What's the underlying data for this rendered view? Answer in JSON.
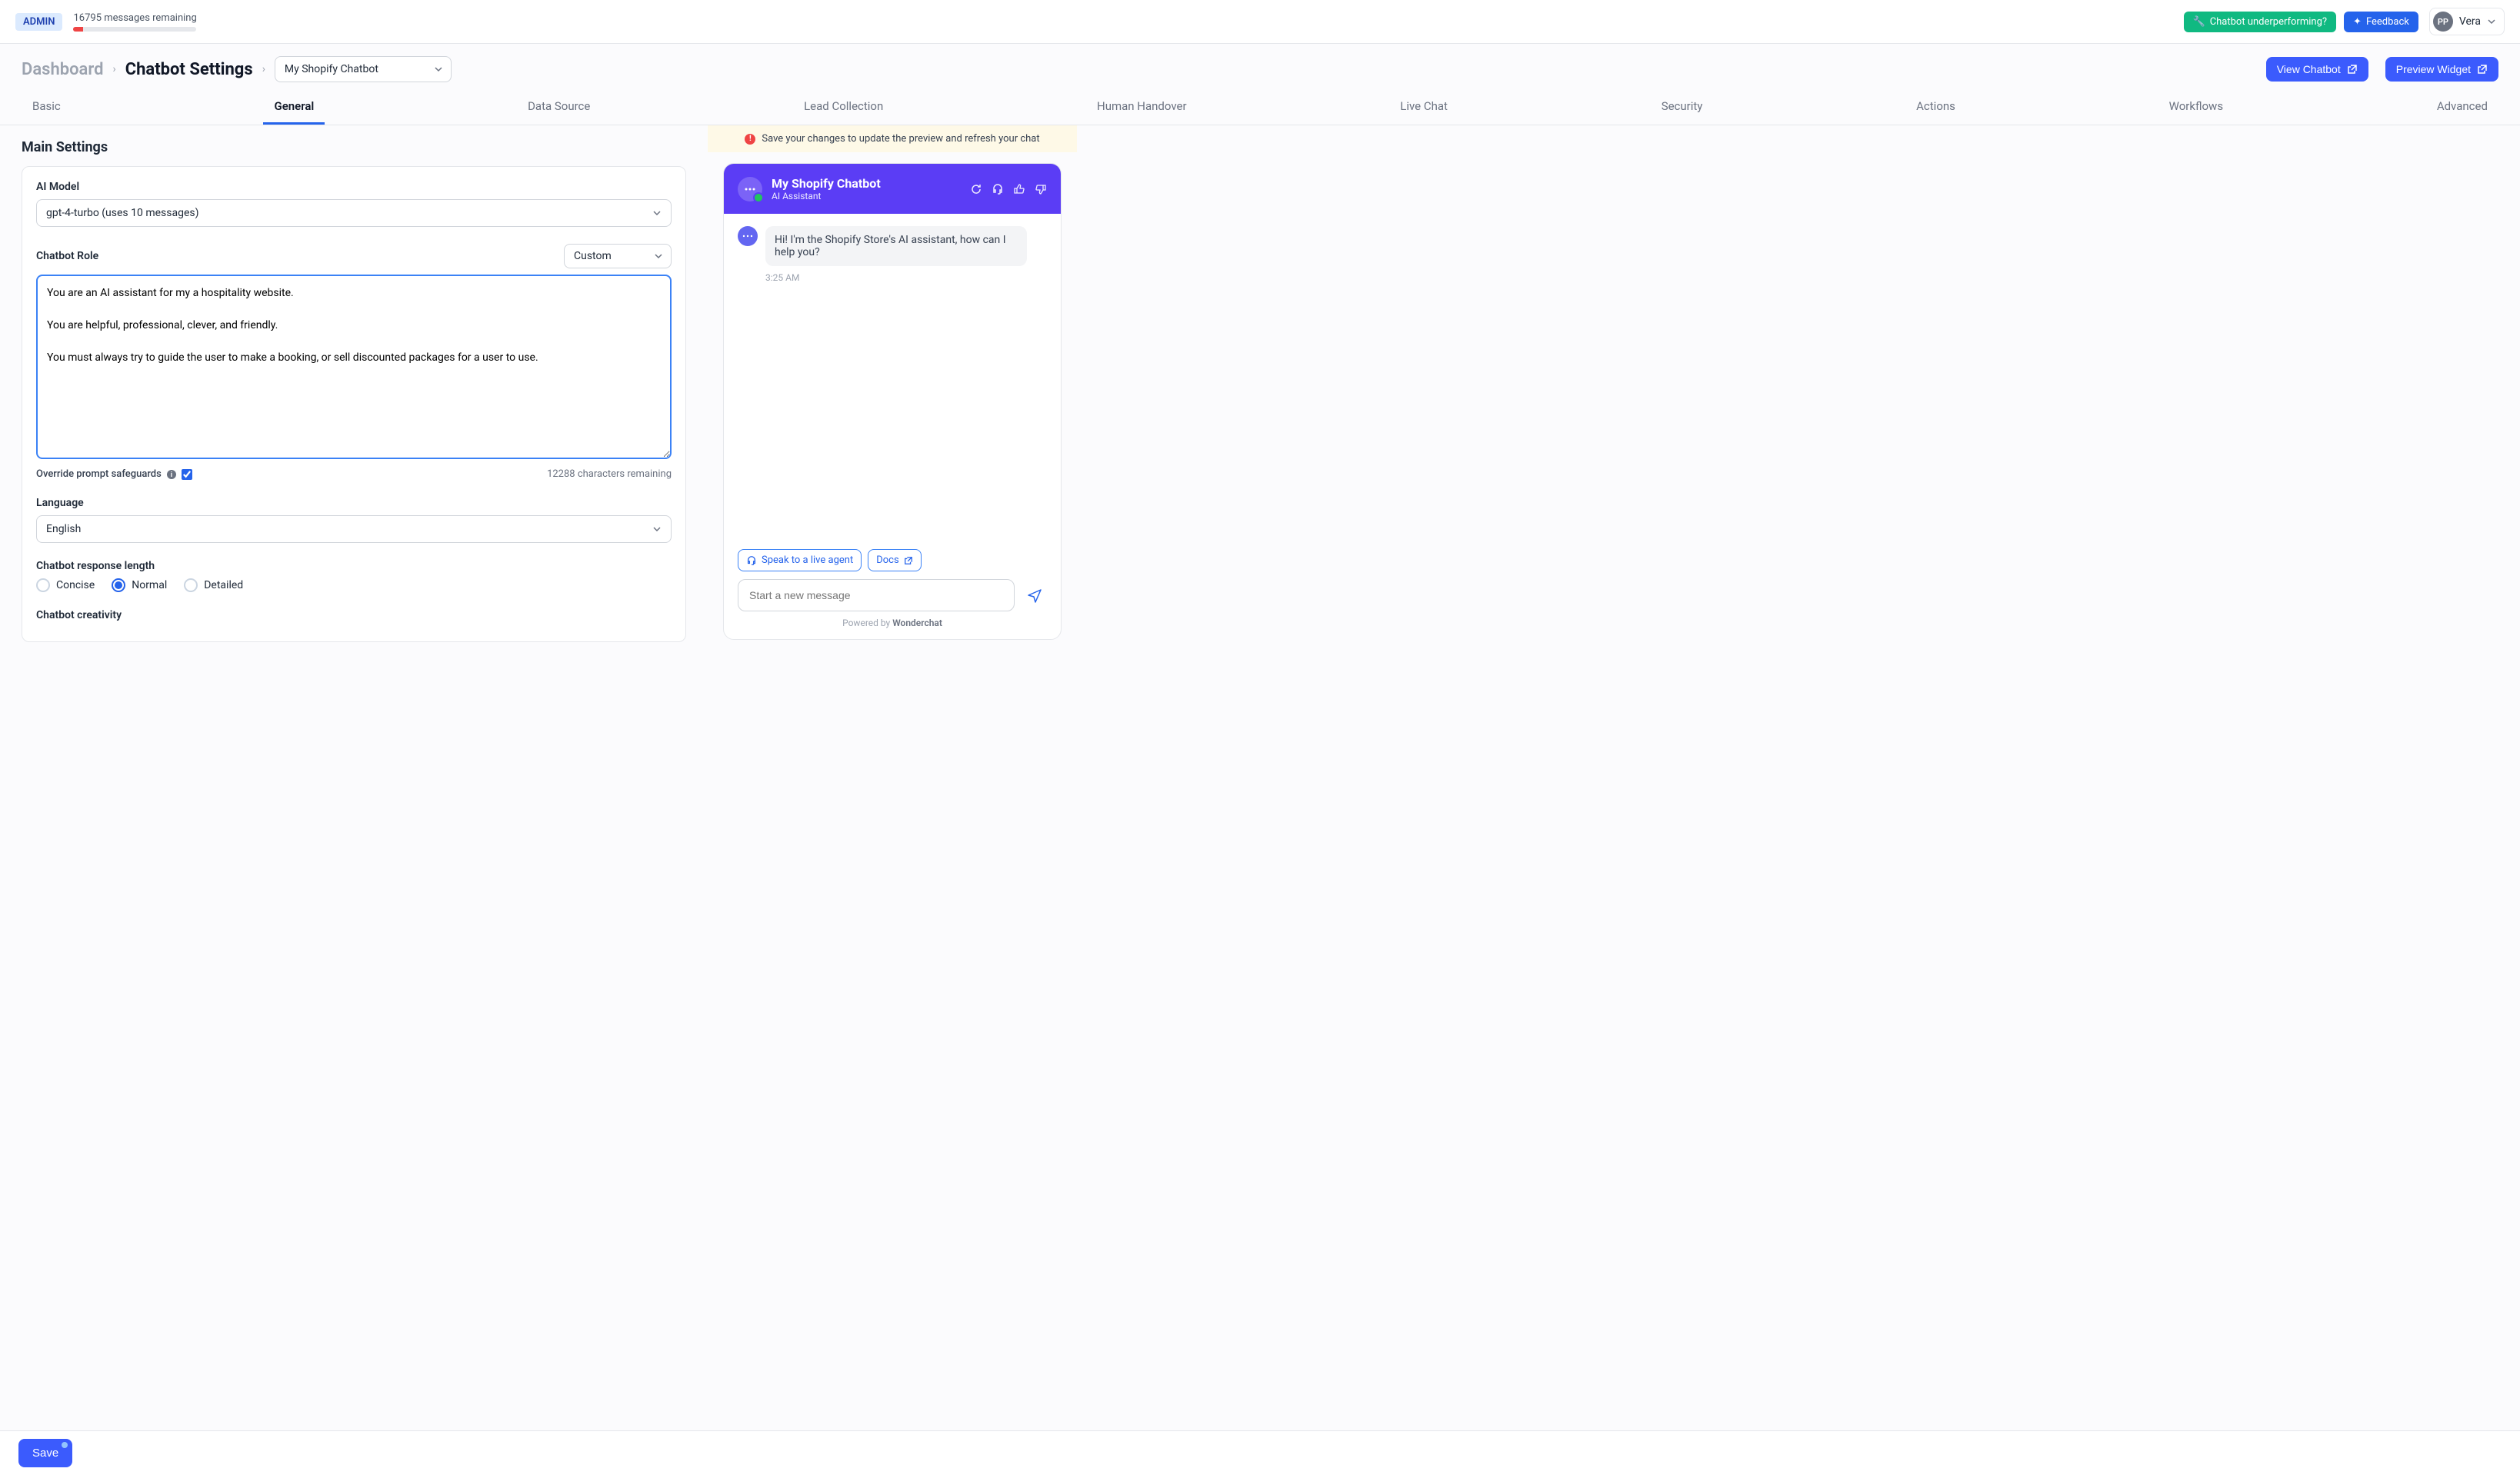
{
  "topbar": {
    "admin_badge": "ADMIN",
    "messages_remaining": "16795 messages remaining",
    "underperforming_label": "Chatbot underperforming?",
    "feedback_label": "Feedback",
    "user_initials": "PP",
    "user_name": "Vera"
  },
  "breadcrumb": {
    "dashboard": "Dashboard",
    "settings": "Chatbot Settings",
    "chatbot_selected": "My Shopify Chatbot"
  },
  "header_actions": {
    "view_chatbot": "View Chatbot",
    "preview_widget": "Preview Widget"
  },
  "tabs": [
    "Basic",
    "General",
    "Data Source",
    "Lead Collection",
    "Human Handover",
    "Live Chat",
    "Security",
    "Actions",
    "Workflows",
    "Advanced"
  ],
  "active_tab_index": 1,
  "section_title": "Main Settings",
  "ai_model": {
    "label": "AI Model",
    "selected": "gpt-4-turbo (uses 10 messages)"
  },
  "chatbot_role": {
    "label": "Chatbot Role",
    "preset_selected": "Custom",
    "prompt": "You are an AI assistant for my a hospitality website.\n\nYou are helpful, professional, clever, and friendly.\n\nYou must always try to guide the user to make a booking, or sell discounted packages for a user to use.",
    "override_label": "Override prompt safeguards",
    "override_checked": true,
    "chars_remaining": "12288 characters remaining"
  },
  "language": {
    "label": "Language",
    "selected": "English"
  },
  "response_length": {
    "label": "Chatbot response length",
    "options": [
      "Concise",
      "Normal",
      "Detailed"
    ],
    "selected_index": 1
  },
  "creativity": {
    "label": "Chatbot creativity"
  },
  "save_button": "Save",
  "preview": {
    "notice": "Save your changes to update the preview and refresh your chat",
    "chat_title": "My Shopify Chatbot",
    "chat_subtitle": "AI Assistant",
    "first_message": "Hi! I'm the Shopify Store's AI assistant, how can I help you?",
    "first_message_time": "3:25 AM",
    "speak_live_agent": "Speak to a live agent",
    "docs_label": "Docs",
    "input_placeholder": "Start a new message",
    "powered_prefix": "Powered by ",
    "powered_brand": "Wonderchat"
  }
}
